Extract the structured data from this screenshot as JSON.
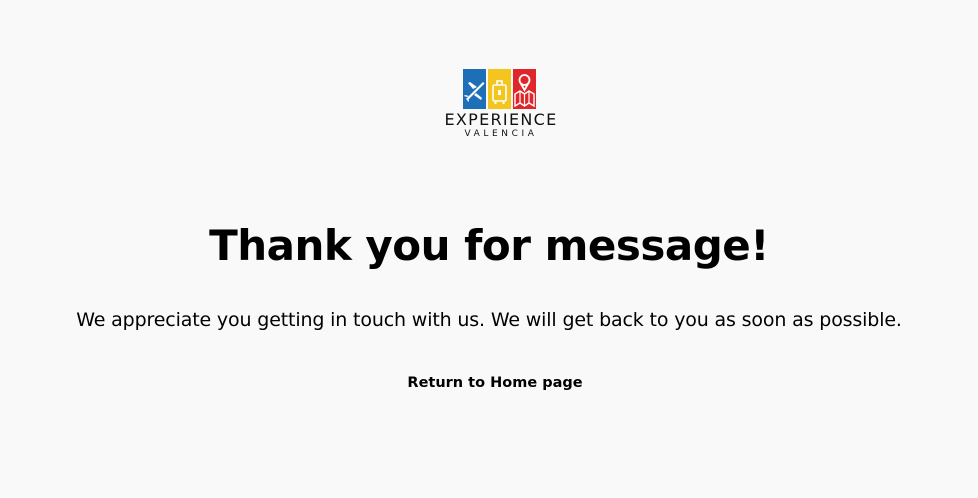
{
  "logo": {
    "word": "EXPERIENCE",
    "sub": "VALENCIA",
    "colors": {
      "blue": "#1d6fb8",
      "yellow": "#f4c51e",
      "red": "#e0262b"
    },
    "icons": [
      "airplane-icon",
      "suitcase-icon",
      "map-pin-icon"
    ]
  },
  "title": "Thank you for message!",
  "message": "We appreciate you getting in touch with us. We will get back to you as soon as possible.",
  "home_link": "Return to Home page"
}
